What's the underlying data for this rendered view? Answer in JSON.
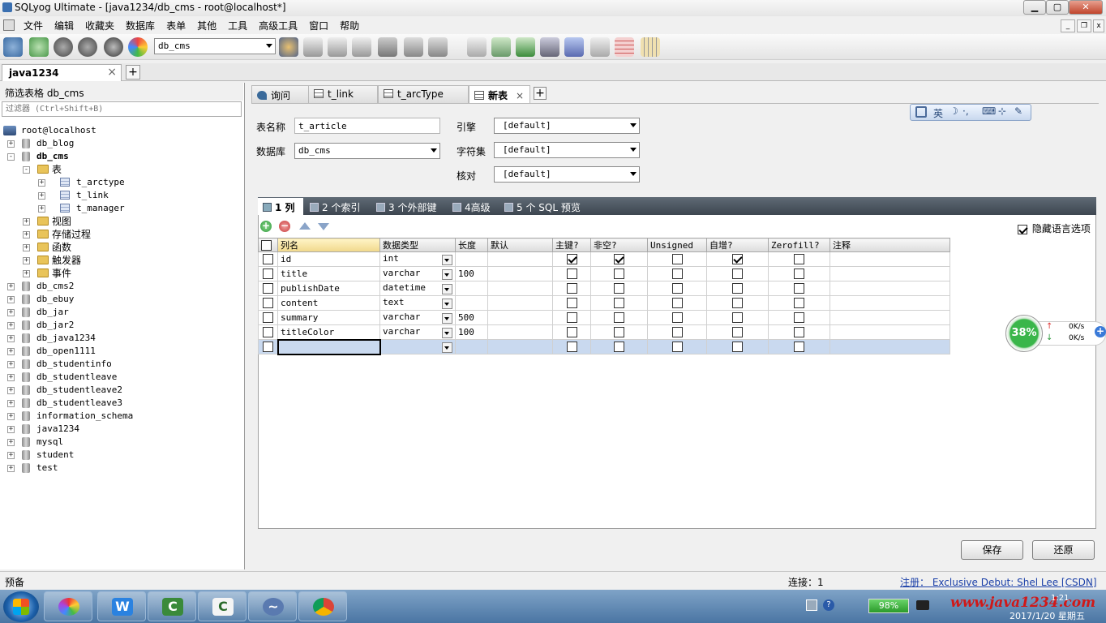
{
  "window": {
    "title": "SQLyog Ultimate - [java1234/db_cms - root@localhost*]",
    "min": "▁",
    "max": "▢",
    "close": "✕"
  },
  "menu": [
    "文件",
    "编辑",
    "收藏夹",
    "数据库",
    "表单",
    "其他",
    "工具",
    "高级工具",
    "窗口",
    "帮助"
  ],
  "toolbar": {
    "db_select": "db_cms"
  },
  "connection_tab": {
    "label": "java1234",
    "close": "×",
    "add": "+"
  },
  "left": {
    "filter_label": "筛选表格 db_cms",
    "filter_placeholder": "过滤器 (Ctrl+Shift+B)",
    "root": "root@localhost",
    "tree": [
      {
        "label": "db_blog",
        "kind": "db",
        "exp": "+",
        "bold": false
      },
      {
        "label": "db_cms",
        "kind": "db",
        "exp": "-",
        "bold": true
      },
      {
        "label": "表",
        "kind": "folder",
        "exp": "-",
        "level": 1
      },
      {
        "label": "t_arctype",
        "kind": "table",
        "exp": "+",
        "level": 2
      },
      {
        "label": "t_link",
        "kind": "table",
        "exp": "+",
        "level": 2
      },
      {
        "label": "t_manager",
        "kind": "table",
        "exp": "+",
        "level": 2
      },
      {
        "label": "视图",
        "kind": "folder",
        "exp": "+",
        "level": 1
      },
      {
        "label": "存储过程",
        "kind": "folder",
        "exp": "+",
        "level": 1
      },
      {
        "label": "函数",
        "kind": "folder",
        "exp": "+",
        "level": 1
      },
      {
        "label": "触发器",
        "kind": "folder",
        "exp": "+",
        "level": 1
      },
      {
        "label": "事件",
        "kind": "folder",
        "exp": "+",
        "level": 1
      },
      {
        "label": "db_cms2",
        "kind": "db",
        "exp": "+"
      },
      {
        "label": "db_ebuy",
        "kind": "db",
        "exp": "+"
      },
      {
        "label": "db_jar",
        "kind": "db",
        "exp": "+"
      },
      {
        "label": "db_jar2",
        "kind": "db",
        "exp": "+"
      },
      {
        "label": "db_java1234",
        "kind": "db",
        "exp": "+"
      },
      {
        "label": "db_open1111",
        "kind": "db",
        "exp": "+"
      },
      {
        "label": "db_studentinfo",
        "kind": "db",
        "exp": "+"
      },
      {
        "label": "db_studentleave",
        "kind": "db",
        "exp": "+"
      },
      {
        "label": "db_studentleave2",
        "kind": "db",
        "exp": "+"
      },
      {
        "label": "db_studentleave3",
        "kind": "db",
        "exp": "+"
      },
      {
        "label": "information_schema",
        "kind": "db",
        "exp": "+"
      },
      {
        "label": "java1234",
        "kind": "db",
        "exp": "+"
      },
      {
        "label": "mysql",
        "kind": "db",
        "exp": "+"
      },
      {
        "label": "student",
        "kind": "db",
        "exp": "+"
      },
      {
        "label": "test",
        "kind": "db",
        "exp": "+"
      }
    ]
  },
  "query_tabs": [
    {
      "label": "询问"
    },
    {
      "label": "t_link"
    },
    {
      "label": "t_arcType"
    },
    {
      "label": "新表",
      "close": "×",
      "active": true
    }
  ],
  "form": {
    "table_name_label": "表名称",
    "table_name": "t_article",
    "database_label": "数据库",
    "database": "db_cms",
    "engine_label": "引擎",
    "engine": "[default]",
    "charset_label": "字符集",
    "charset": "[default]",
    "collation_label": "核对",
    "collation": "[default]"
  },
  "ime_bar": {
    "lang": "英"
  },
  "inner_tabs": [
    "1 列",
    "2 个索引",
    "3 个外部键",
    "4高级",
    "5 个 SQL 预览"
  ],
  "hide_lang_opts": "隐藏语言选项",
  "grid": {
    "headers": [
      "列名",
      "数据类型",
      "长度",
      "默认",
      "主键?",
      "非空?",
      "Unsigned",
      "自增?",
      "Zerofill?",
      "注释"
    ],
    "rows": [
      {
        "name": "id",
        "type": "int",
        "len": "",
        "def": "",
        "pk": true,
        "nn": true,
        "un": false,
        "ai": true,
        "zf": false,
        "comment": ""
      },
      {
        "name": "title",
        "type": "varchar",
        "len": "100",
        "def": "",
        "pk": false,
        "nn": false,
        "un": false,
        "ai": false,
        "zf": false,
        "comment": ""
      },
      {
        "name": "publishDate",
        "type": "datetime",
        "len": "",
        "def": "",
        "pk": false,
        "nn": false,
        "un": false,
        "ai": false,
        "zf": false,
        "comment": ""
      },
      {
        "name": "content",
        "type": "text",
        "len": "",
        "def": "",
        "pk": false,
        "nn": false,
        "un": false,
        "ai": false,
        "zf": false,
        "comment": ""
      },
      {
        "name": "summary",
        "type": "varchar",
        "len": "500",
        "def": "",
        "pk": false,
        "nn": false,
        "un": false,
        "ai": false,
        "zf": false,
        "comment": ""
      },
      {
        "name": "titleColor",
        "type": "varchar",
        "len": "100",
        "def": "",
        "pk": false,
        "nn": false,
        "un": false,
        "ai": false,
        "zf": false,
        "comment": ""
      }
    ]
  },
  "buttons": {
    "save": "保存",
    "revert": "还原"
  },
  "net_widget": {
    "percent": "38%",
    "up": "0K/s",
    "down": "0K/s"
  },
  "status": {
    "left": "预备",
    "connection": "连接：1",
    "register": "注册： Exclusive Debut: Shel Lee [CSDN]"
  },
  "taskbar": {
    "battery": "98%",
    "watermark": "www.java1234.com",
    "date": "2017/1/20 星期五",
    "time": "1:21"
  },
  "colors": {
    "accent_green": "#2e9a3c",
    "grid_selected": "#c9d9ef",
    "inner_tab_bg": "#4a545f",
    "watermark_red": "#d01818"
  }
}
